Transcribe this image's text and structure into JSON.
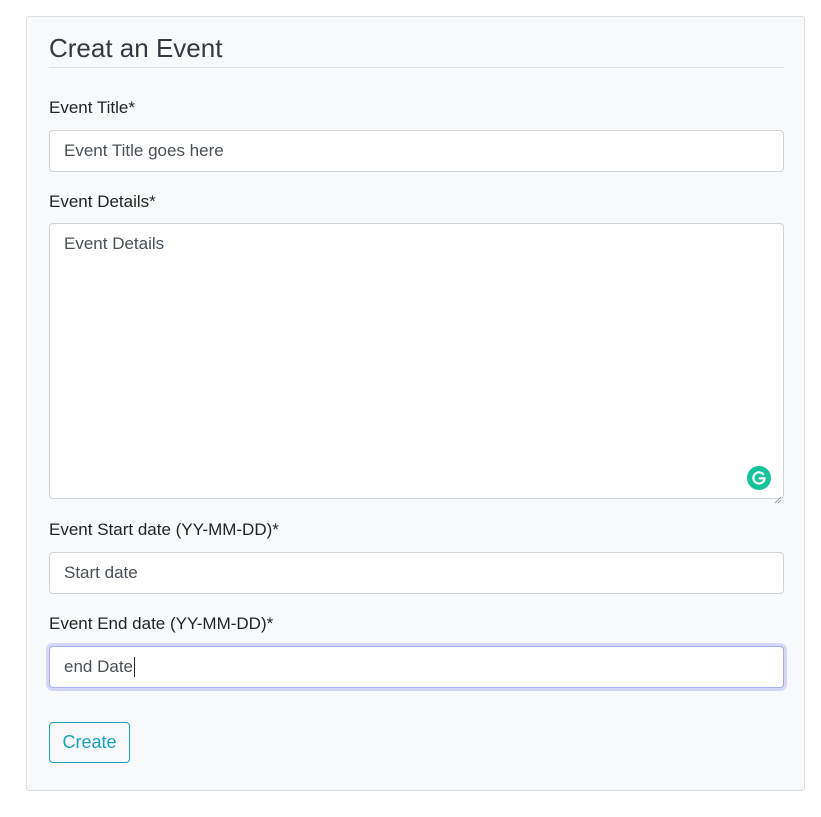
{
  "form": {
    "title": "Creat an Event",
    "fields": {
      "event_title": {
        "label": "Event Title*",
        "placeholder": "Event Title goes here",
        "value": ""
      },
      "event_details": {
        "label": "Event Details*",
        "placeholder": "Event Details",
        "value": ""
      },
      "start_date": {
        "label": "Event Start date (YY-MM-DD)*",
        "placeholder": "Start date",
        "value": ""
      },
      "end_date": {
        "label": "Event End date (YY-MM-DD)*",
        "placeholder": "",
        "value": "end Date",
        "focused": true
      }
    },
    "submit_label": "Create"
  },
  "icons": {
    "grammarly": "grammarly-g-icon",
    "resize": "resize-handle-icon"
  },
  "colors": {
    "accent": "#17a2b8",
    "grammarly": "#15c39a",
    "focus_ring": "#a8aef0"
  }
}
